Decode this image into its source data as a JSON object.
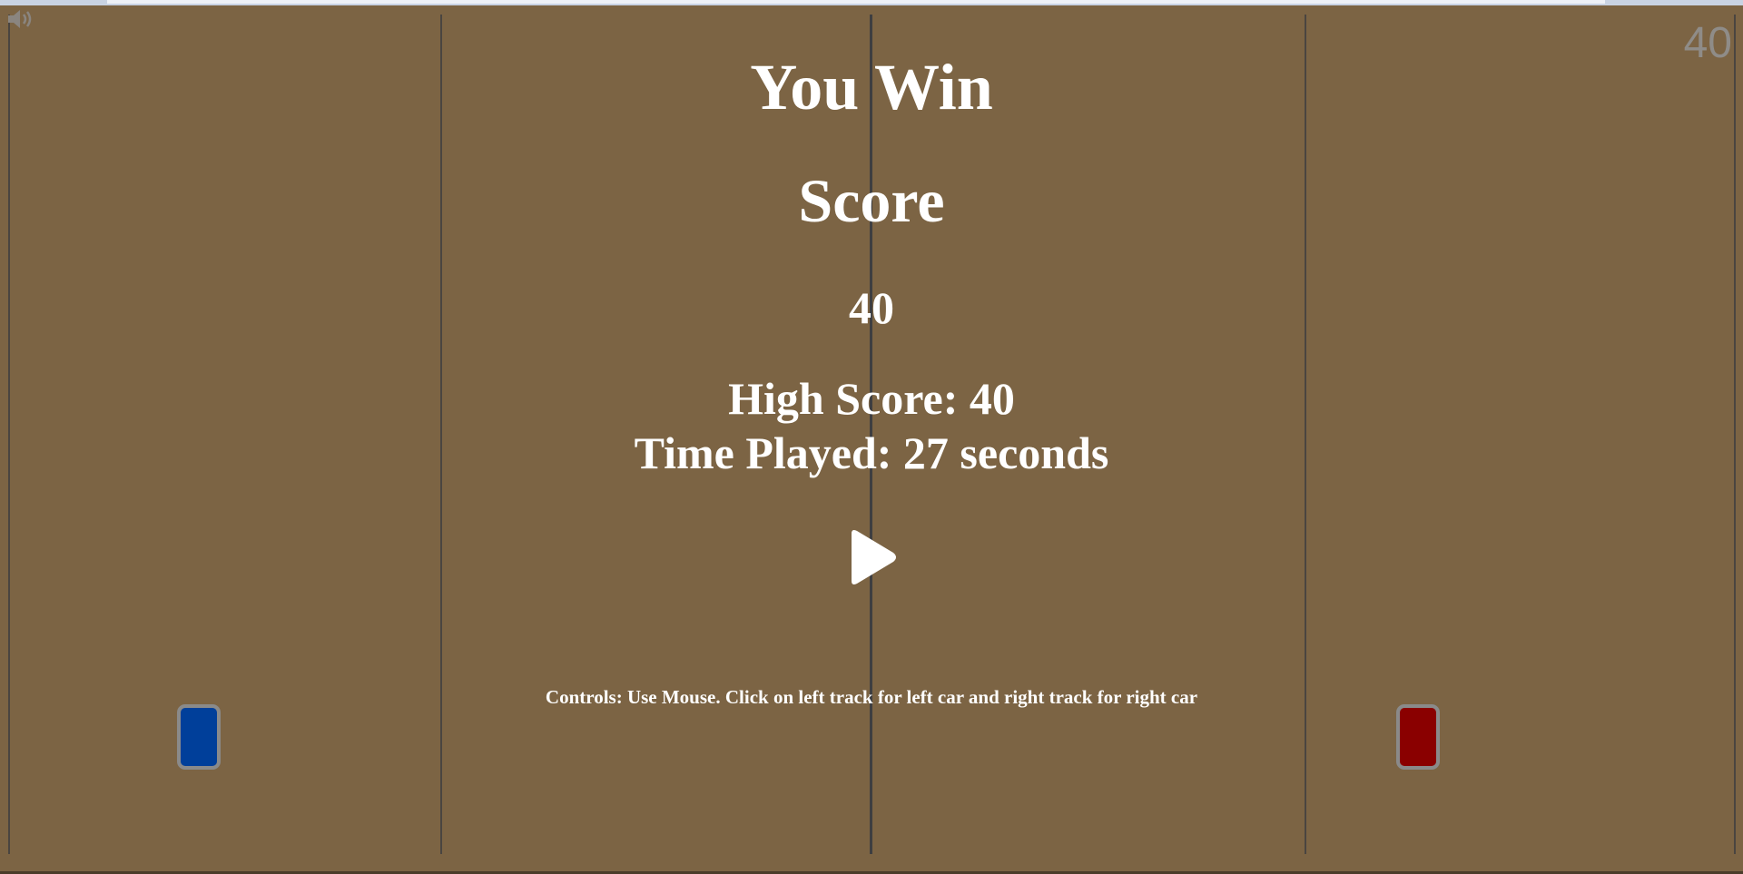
{
  "colors": {
    "background": "#7c6444",
    "text": "#ffffff",
    "track_line": "#4a4540",
    "left_car": "#003f9a",
    "right_car": "#8a0000",
    "car_border": "#8a8a8a",
    "score_counter": "#8f8c88"
  },
  "hud": {
    "score_counter": "40",
    "sound_icon": "speaker-icon"
  },
  "end_screen": {
    "title": "You Win",
    "score_label": "Score",
    "score_value": "40",
    "high_score": "High Score: 40",
    "time_played": "Time Played: 27 seconds",
    "play_icon": "play-icon",
    "controls": "Controls: Use Mouse. Click on left track for left car and right track for right car"
  },
  "cars": {
    "left": "blue-car",
    "right": "red-car"
  }
}
